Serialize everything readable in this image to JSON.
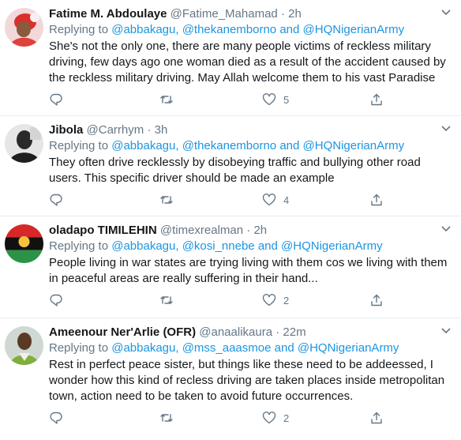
{
  "tweets": [
    {
      "display_name": "Fatime M. Abdoulaye",
      "handle": "@Fatime_Mahamad",
      "separator": "·",
      "time": "2h",
      "replying_prefix": "Replying to",
      "mentions": [
        "@abbakagu",
        "@thekanemborno",
        "@HQNigerianArmy"
      ],
      "comma": ",",
      "and_word": "and",
      "text": "She's not the only one, there are many people victims of reckless military driving, few days ago one woman died as a result of the accident caused by the reckless military driving. May Allah welcome them to his vast Paradise",
      "likes": "5"
    },
    {
      "display_name": "Jibola",
      "handle": "@Carrhym",
      "separator": "·",
      "time": "3h",
      "replying_prefix": "Replying to",
      "mentions": [
        "@abbakagu",
        "@thekanemborno",
        "@HQNigerianArmy"
      ],
      "comma": ",",
      "and_word": "and",
      "text": "They often drive recklessly by disobeying traffic and bullying other road users. This specific driver should be made an example",
      "likes": "4"
    },
    {
      "display_name": "oladapo TIMILEHIN",
      "handle": "@timexrealman",
      "separator": "·",
      "time": "2h",
      "replying_prefix": "Replying to",
      "mentions": [
        "@abbakagu",
        "@kosi_nnebe",
        "@HQNigerianArmy"
      ],
      "comma": ",",
      "and_word": "and",
      "text": "People living in war states are trying living with them cos we living with them in peaceful areas are really suffering in their hand...",
      "likes": "2"
    },
    {
      "display_name": "Ameenour Ner'Arlie (OFR)",
      "handle": "@anaalikaura",
      "separator": "·",
      "time": "22m",
      "replying_prefix": "Replying to",
      "mentions": [
        "@abbakagu",
        "@mss_aaasmoe",
        "@HQNigerianArmy"
      ],
      "comma": ",",
      "and_word": "and",
      "text": "Rest in perfect peace sister, but things like these need to be addeessed, I wonder how this kind of recless driving are taken places inside metropolitan town, action need to be taken to avoid future occurrences.",
      "likes": "2"
    }
  ],
  "icons": {
    "reply": "reply-icon",
    "retweet": "retweet-icon",
    "like": "heart-icon",
    "share": "share-icon",
    "caret": "chevron-down-icon"
  },
  "colors": {
    "text": "#14171a",
    "secondary": "#657786",
    "link": "#1b95e0",
    "divider": "#e6ecf0"
  }
}
